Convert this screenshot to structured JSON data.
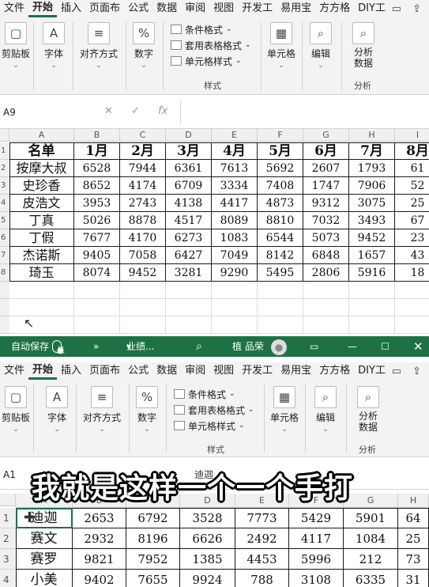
{
  "top_window": {
    "tabs": [
      "文件",
      "开始",
      "插入",
      "页面布",
      "公式",
      "数据",
      "审阅",
      "视图",
      "开发工",
      "易用宝",
      "方方格",
      "DIY工"
    ],
    "active_tab": "开始",
    "groups": {
      "clipboard": "剪贴板",
      "font": "字体",
      "align": "对齐方式",
      "number": "数字",
      "cond_format": "条件格式",
      "table_format": "套用表格格式",
      "cell_style": "单元格样式",
      "styles_label": "样式",
      "cells": "单元格",
      "edit": "编辑",
      "analyze": "分析数据",
      "analyze_label": "分析"
    },
    "name_box": "A9",
    "columns": [
      "A",
      "B",
      "C",
      "D",
      "E",
      "F",
      "G",
      "H",
      "I"
    ],
    "header_row": [
      "名单",
      "1月",
      "2月",
      "3月",
      "4月",
      "5月",
      "6月",
      "7月",
      "8月"
    ],
    "rows": [
      [
        "按摩大叔",
        "6528",
        "7944",
        "6361",
        "7613",
        "5692",
        "2607",
        "1793",
        "61"
      ],
      [
        "史珍香",
        "8652",
        "4174",
        "6709",
        "3334",
        "7408",
        "1747",
        "7906",
        "52"
      ],
      [
        "皮浩文",
        "3953",
        "2743",
        "4138",
        "4417",
        "4873",
        "9312",
        "3075",
        "25"
      ],
      [
        "丁真",
        "5026",
        "8878",
        "4517",
        "8089",
        "8810",
        "7032",
        "3493",
        "67"
      ],
      [
        "丁假",
        "7677",
        "4170",
        "6273",
        "1083",
        "6544",
        "5073",
        "9452",
        "23"
      ],
      [
        "杰诺斯",
        "9405",
        "7058",
        "6427",
        "7049",
        "8142",
        "6848",
        "1657",
        "43"
      ],
      [
        "琦玉",
        "8074",
        "9452",
        "3281",
        "9290",
        "5495",
        "2806",
        "5916",
        "18"
      ]
    ],
    "row_numbers": [
      "1",
      "2",
      "3",
      "4",
      "5",
      "6",
      "7",
      "8"
    ]
  },
  "bottom_window": {
    "autosave": "自动保存",
    "autosave_state": "关",
    "more": "»",
    "doc_name": "业绩...",
    "user": "植 品荣",
    "tabs": [
      "文件",
      "开始",
      "插入",
      "页面布",
      "公式",
      "数据",
      "审阅",
      "视图",
      "开发工",
      "易用宝",
      "方方格",
      "DIY工"
    ],
    "active_tab": "开始",
    "groups": {
      "clipboard": "剪贴板",
      "font": "字体",
      "align": "对齐方式",
      "number": "数字",
      "cond_format": "条件格式",
      "table_format": "套用表格格式",
      "cell_style": "单元格样式",
      "styles_label": "样式",
      "cells": "单元格",
      "edit": "编辑",
      "analyze": "分析数据",
      "analyze_label": "分析"
    },
    "name_box": "A1",
    "formula_value": "迪迦",
    "columns": [
      "A",
      "B",
      "C",
      "D",
      "E",
      "F",
      "G",
      "H"
    ],
    "rows": [
      [
        "迪迦",
        "2653",
        "6792",
        "3528",
        "7773",
        "5429",
        "5901",
        "64"
      ],
      [
        "赛文",
        "2932",
        "8196",
        "6626",
        "2492",
        "4117",
        "1084",
        "25"
      ],
      [
        "赛罗",
        "9821",
        "7952",
        "1385",
        "4453",
        "5996",
        "212",
        "73"
      ],
      [
        "小美",
        "9402",
        "7655",
        "9924",
        "788",
        "3108",
        "6335",
        "31"
      ]
    ],
    "row_numbers": [
      "1",
      "2",
      "3",
      "4"
    ]
  },
  "subtitle": "我就是这样一个一个手打",
  "colors": {
    "excel_green": "#1e7145",
    "ribbon_bg": "#f3f3f3"
  }
}
